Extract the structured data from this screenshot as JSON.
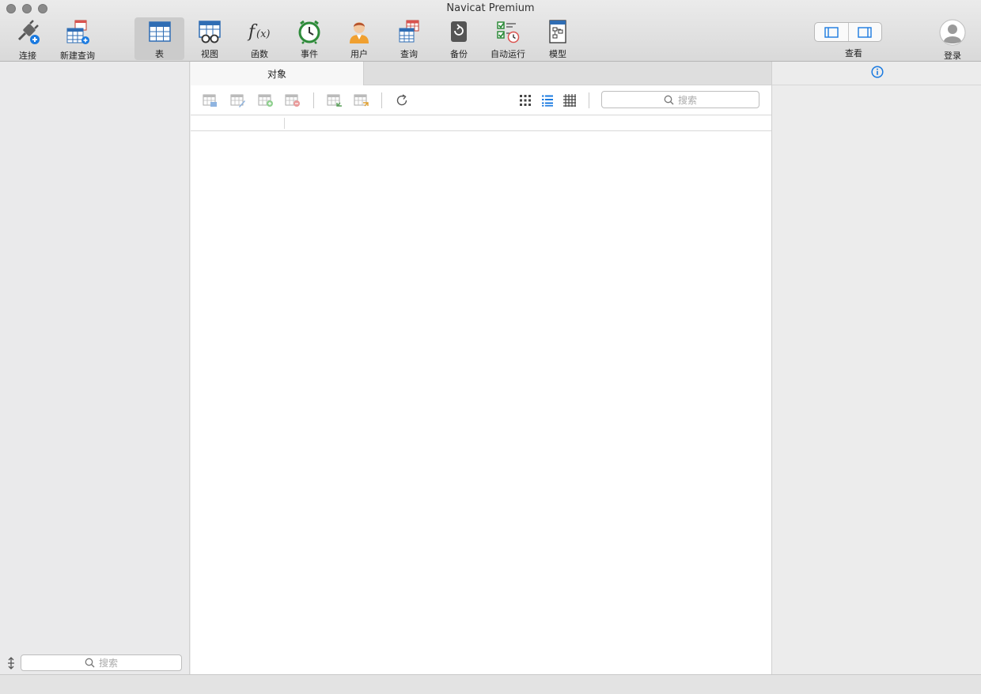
{
  "window": {
    "title": "Navicat Premium"
  },
  "toolbar": {
    "items": [
      {
        "label": "连接",
        "icon": "connection-plug-icon"
      },
      {
        "label": "新建查询",
        "icon": "new-query-icon"
      },
      {
        "label": "表",
        "icon": "table-icon",
        "active": true
      },
      {
        "label": "视图",
        "icon": "view-icon"
      },
      {
        "label": "函数",
        "icon": "function-icon"
      },
      {
        "label": "事件",
        "icon": "event-clock-icon"
      },
      {
        "label": "用户",
        "icon": "user-icon"
      },
      {
        "label": "查询",
        "icon": "query-icon"
      },
      {
        "label": "备份",
        "icon": "backup-icon"
      },
      {
        "label": "自动运行",
        "icon": "automation-icon"
      },
      {
        "label": "模型",
        "icon": "model-icon"
      }
    ],
    "view_label": "查看",
    "login_label": "登录"
  },
  "main": {
    "tab_label": "对象",
    "search_placeholder": "搜索"
  },
  "sidebar": {
    "search_placeholder": "搜索"
  },
  "colors": {
    "accent": "#1a7ae0",
    "table_blue": "#2f6db4",
    "red": "#d9534f",
    "green": "#2e8b3a",
    "orange": "#f0a030"
  }
}
